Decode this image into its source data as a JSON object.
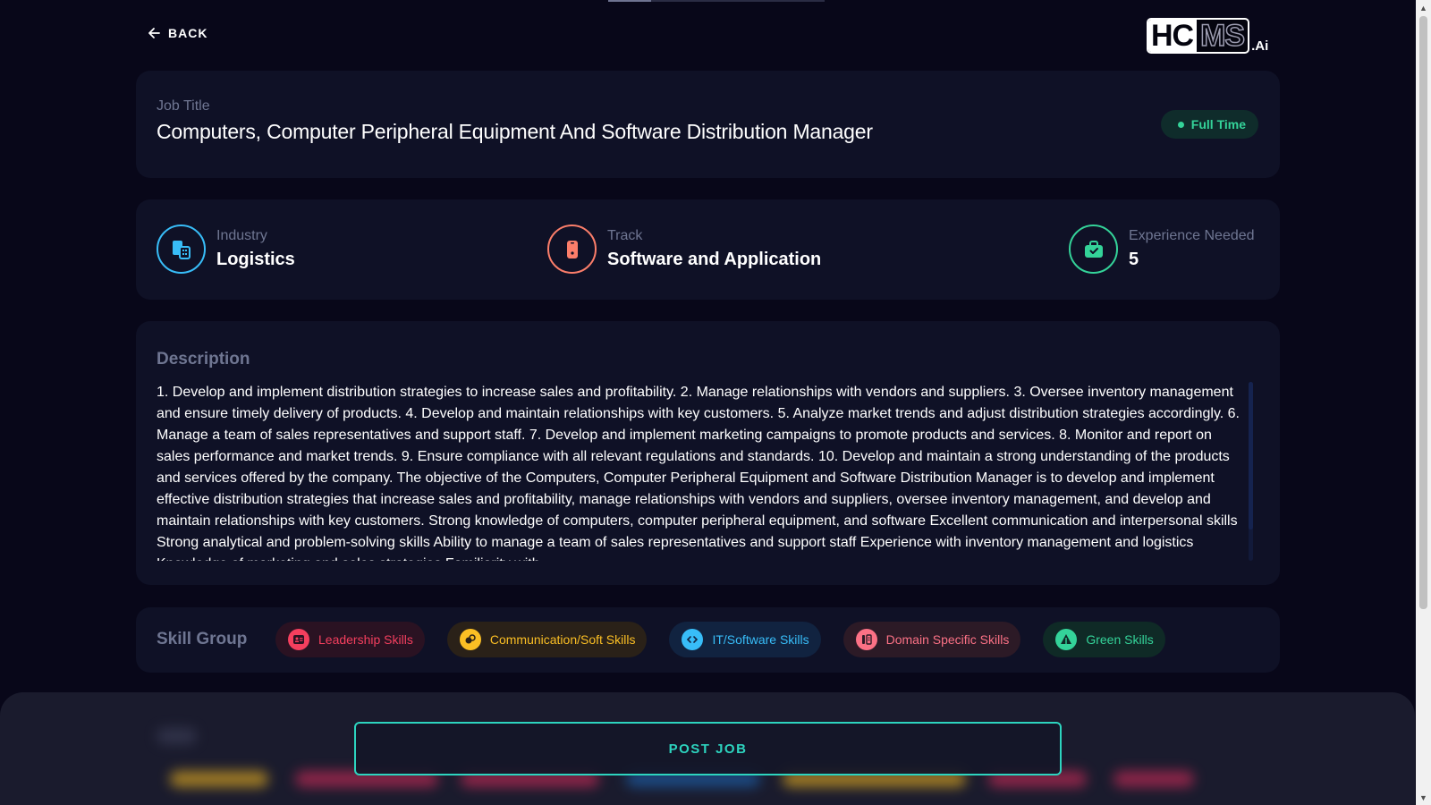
{
  "nav": {
    "back_label": "BACK"
  },
  "logo": {
    "text_hc": "HC",
    "text_ms": "MS",
    "text_ai": ".Ai"
  },
  "job": {
    "title_label": "Job Title",
    "title": "Computers, Computer Peripheral Equipment And Software Distribution Manager",
    "type_badge": "Full Time"
  },
  "info": {
    "industry": {
      "label": "Industry",
      "value": "Logistics",
      "icon": "industry-icon",
      "color": "#38bdf8"
    },
    "track": {
      "label": "Track",
      "value": "Software and Application",
      "icon": "phone-icon",
      "color": "#fb7e6a"
    },
    "experience": {
      "label": "Experience Needed",
      "value": "5",
      "icon": "briefcase-icon",
      "color": "#34d399"
    }
  },
  "description": {
    "heading": "Description",
    "text": "1. Develop and implement distribution strategies to increase sales and profitability. 2. Manage relationships with vendors and suppliers. 3. Oversee inventory management and ensure timely delivery of products. 4. Develop and maintain relationships with key customers. 5. Analyze market trends and adjust distribution strategies accordingly. 6. Manage a team of sales representatives and support staff. 7. Develop and implement marketing campaigns to promote products and services. 8. Monitor and report on sales performance and market trends. 9. Ensure compliance with all relevant regulations and standards. 10. Develop and maintain a strong understanding of the products and services offered by the company. The objective of the Computers, Computer Peripheral Equipment and Software Distribution Manager is to develop and implement effective distribution strategies that increase sales and profitability, manage relationships with vendors and suppliers, oversee inventory management, and develop and maintain relationships with key customers. Strong knowledge of computers, computer peripheral equipment, and software Excellent communication and interpersonal skills Strong analytical and problem-solving skills Ability to manage a team of sales representatives and support staff Experience with inventory management and logistics Knowledge of marketing and sales strategies Familiarity with"
  },
  "skills": {
    "heading": "Skill Group",
    "groups": [
      {
        "label": "Leadership Skills",
        "icon": "leadership-icon",
        "color": "#f43f5e",
        "bg": "#2a1222"
      },
      {
        "label": "Communication/Soft Skills",
        "icon": "communication-icon",
        "color": "#fbbf24",
        "bg": "#2a2118"
      },
      {
        "label": "IT/Software Skills",
        "icon": "it-software-icon",
        "color": "#38bdf8",
        "bg": "#112340"
      },
      {
        "label": "Domain Specific Skills",
        "icon": "domain-icon",
        "color": "#fb7185",
        "bg": "#2c1a26"
      },
      {
        "label": "Green Skills",
        "icon": "green-icon",
        "color": "#34d399",
        "bg": "#0f2a26"
      }
    ]
  },
  "actions": {
    "post_job_label": "POST JOB"
  }
}
